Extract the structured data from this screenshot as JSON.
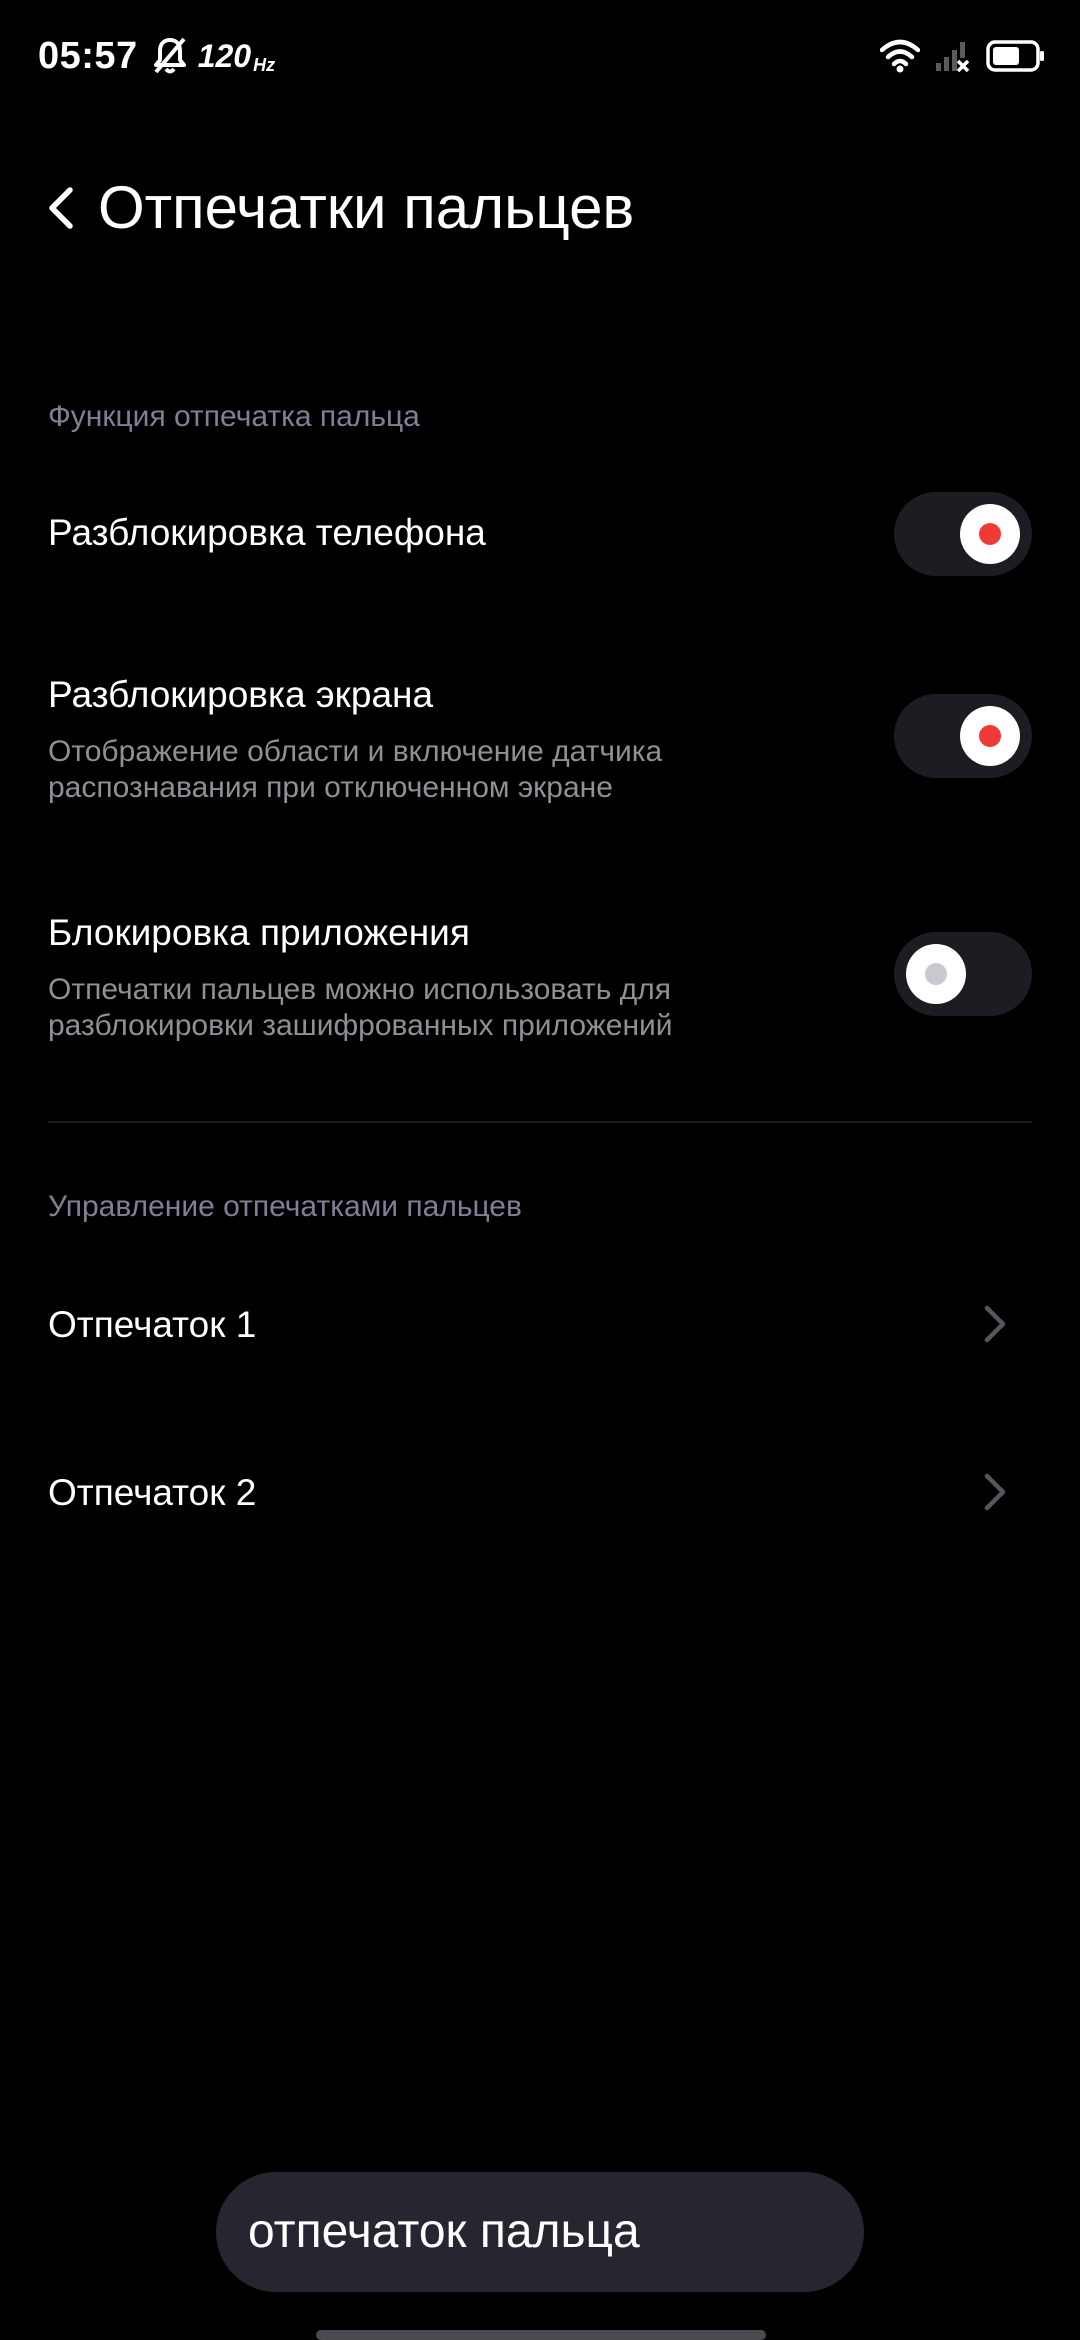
{
  "status_bar": {
    "time": "05:57",
    "refresh_rate": "120",
    "refresh_rate_unit": "Hz",
    "icons": [
      "bell-off-icon",
      "wifi-icon",
      "no-signal-icon",
      "battery-icon"
    ]
  },
  "header": {
    "title": "Отпечатки пальцев"
  },
  "sections": {
    "function": {
      "title": "Функция отпечатка пальца",
      "items": [
        {
          "title": "Разблокировка телефона",
          "subtitle": "",
          "enabled": true
        },
        {
          "title": "Разблокировка экрана",
          "subtitle": "Отображение области и включение датчика распознавания при отключенном экране",
          "enabled": true
        },
        {
          "title": "Блокировка приложения",
          "subtitle": "Отпечатки пальцев можно использовать для разблокировки зашифрованных приложений",
          "enabled": false
        }
      ]
    },
    "management": {
      "title": "Управление отпечатками пальцев",
      "items": [
        {
          "title": "Отпечаток 1"
        },
        {
          "title": "Отпечаток 2"
        }
      ]
    }
  },
  "bottom_search": {
    "text": "отпечаток пальца"
  },
  "colors": {
    "background": "#000000",
    "toggle_track": "#1c1c22",
    "toggle_on_dot": "#ef3b33",
    "section_header": "#7f8096",
    "subtitle": "#8f8f96",
    "pill": "#25262f"
  }
}
